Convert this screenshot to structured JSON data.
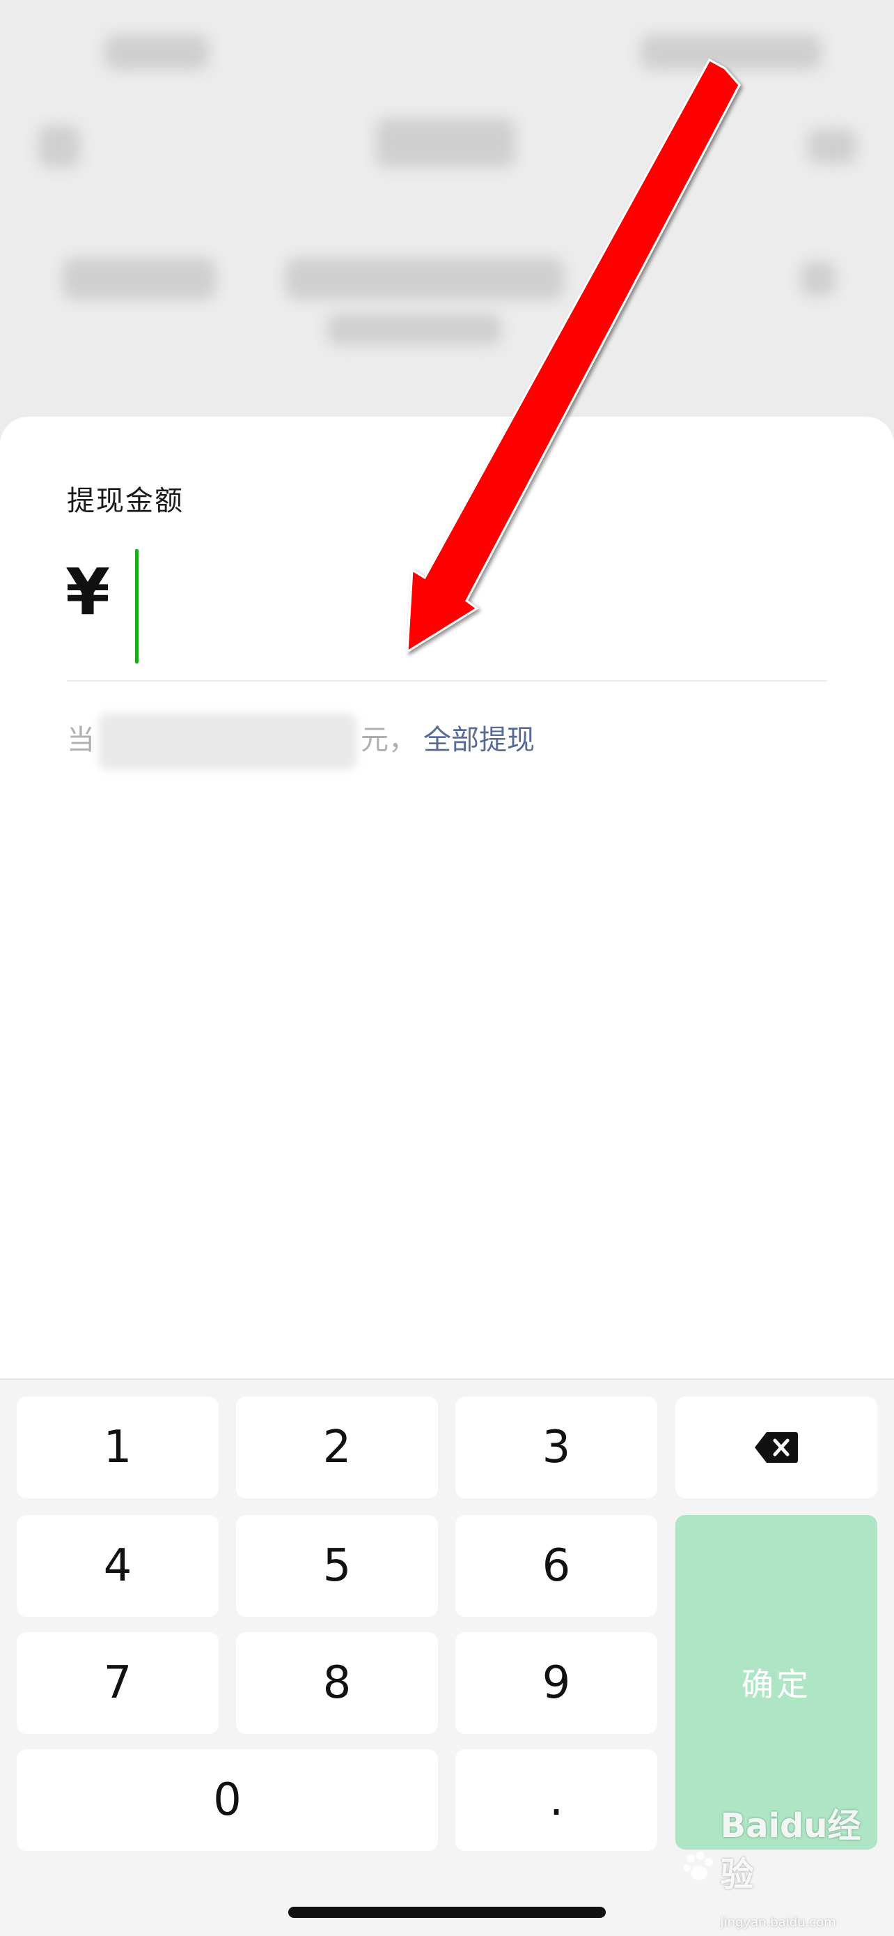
{
  "sheet": {
    "title": "提现金额",
    "currency_symbol": "¥",
    "amount_value": "",
    "balance_prefix": "当",
    "balance_suffix": "元，",
    "withdraw_all_label": "全部提现"
  },
  "keypad": {
    "keys": [
      "1",
      "2",
      "3",
      "4",
      "5",
      "6",
      "7",
      "8",
      "9",
      "0",
      "."
    ],
    "backspace_icon": "backspace-icon",
    "confirm_label": "确定"
  },
  "annotation": {
    "arrow_icon": "red-arrow-icon",
    "arrow_color": "#ff0000"
  },
  "watermark": {
    "brand": "Baidu",
    "suffix": "经验",
    "site": "jingyan.baidu.com"
  },
  "colors": {
    "cursor": "#1aad19",
    "link": "#576b95",
    "confirm_disabled": "#ade5c5"
  }
}
